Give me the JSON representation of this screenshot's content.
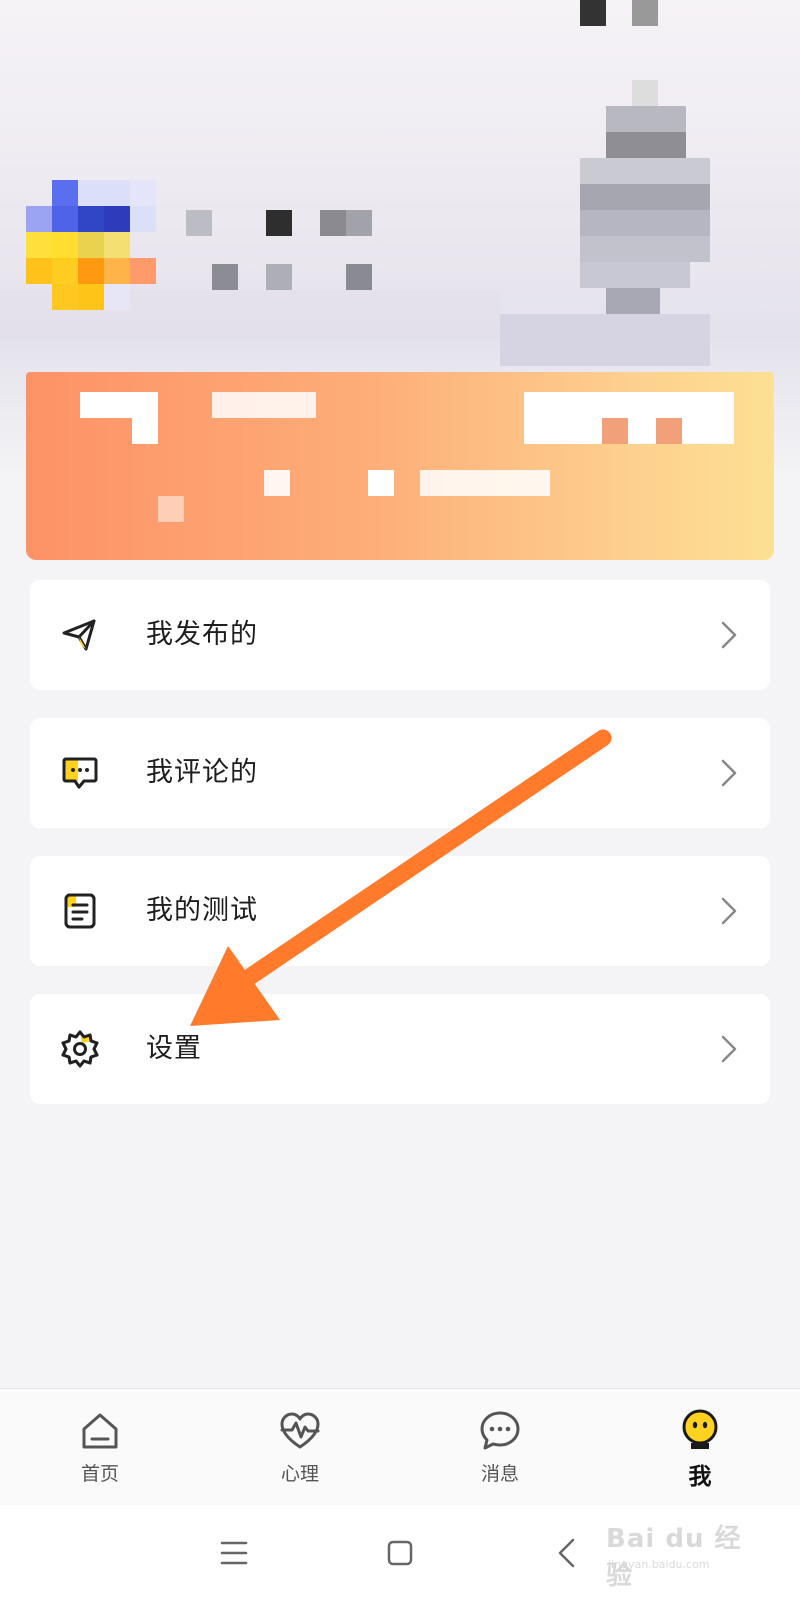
{
  "menu": {
    "items": [
      {
        "label": "我发布的",
        "icon": "paper-plane-icon"
      },
      {
        "label": "我评论的",
        "icon": "comment-bubble-icon"
      },
      {
        "label": "我的测试",
        "icon": "clipboard-icon"
      },
      {
        "label": "设置",
        "icon": "gear-icon"
      }
    ]
  },
  "tabbar": {
    "tabs": [
      {
        "label": "首页",
        "icon": "home-icon"
      },
      {
        "label": "心理",
        "icon": "heart-pulse-icon"
      },
      {
        "label": "消息",
        "icon": "message-bubble-icon"
      },
      {
        "label": "我",
        "icon": "smiley-avatar-icon",
        "active": true
      }
    ]
  },
  "navbar": {
    "buttons": [
      "menu-icon",
      "home-square-icon",
      "back-chevron-icon"
    ]
  },
  "watermark": {
    "brand": "Bai du 经验",
    "url": "jingyan.baidu.com"
  },
  "colors": {
    "accent": "#ff7a2a",
    "icon_yellow": "#ffd21f",
    "banner_start": "#fd9266",
    "banner_end": "#fde094",
    "background": "#f4f4f6"
  }
}
